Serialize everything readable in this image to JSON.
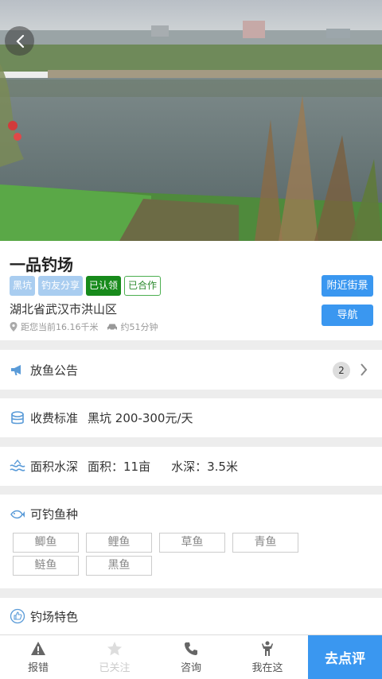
{
  "spot": {
    "name": "一品钓场",
    "tags": [
      "黑坑",
      "钓友分享",
      "已认领",
      "已合作"
    ],
    "address": "湖北省武汉市洪山区",
    "distance": "距您当前16.16千米",
    "drive_time": "约51分钟",
    "street_view_label": "附近街景",
    "navigate_label": "导航"
  },
  "notice": {
    "label": "放鱼公告",
    "count": "2"
  },
  "fee": {
    "label": "收费标准",
    "value": "黑坑 200-300元/天"
  },
  "area": {
    "label": "面积水深",
    "area_text": "面积：11亩",
    "depth_text": "水深：3.5米"
  },
  "fish": {
    "label": "可钓鱼种",
    "items": [
      "鲫鱼",
      "鲤鱼",
      "草鱼",
      "青鱼",
      "鲢鱼",
      "黑鱼"
    ]
  },
  "feature": {
    "label": "钓场特色"
  },
  "tabbar": {
    "report": "报错",
    "follow": "已关注",
    "consult": "咨询",
    "here": "我在这",
    "review": "去点评"
  },
  "colors": {
    "accent": "#3a97f0",
    "tag_blue": "#a9cdf0",
    "tag_green": "#178a1b"
  }
}
